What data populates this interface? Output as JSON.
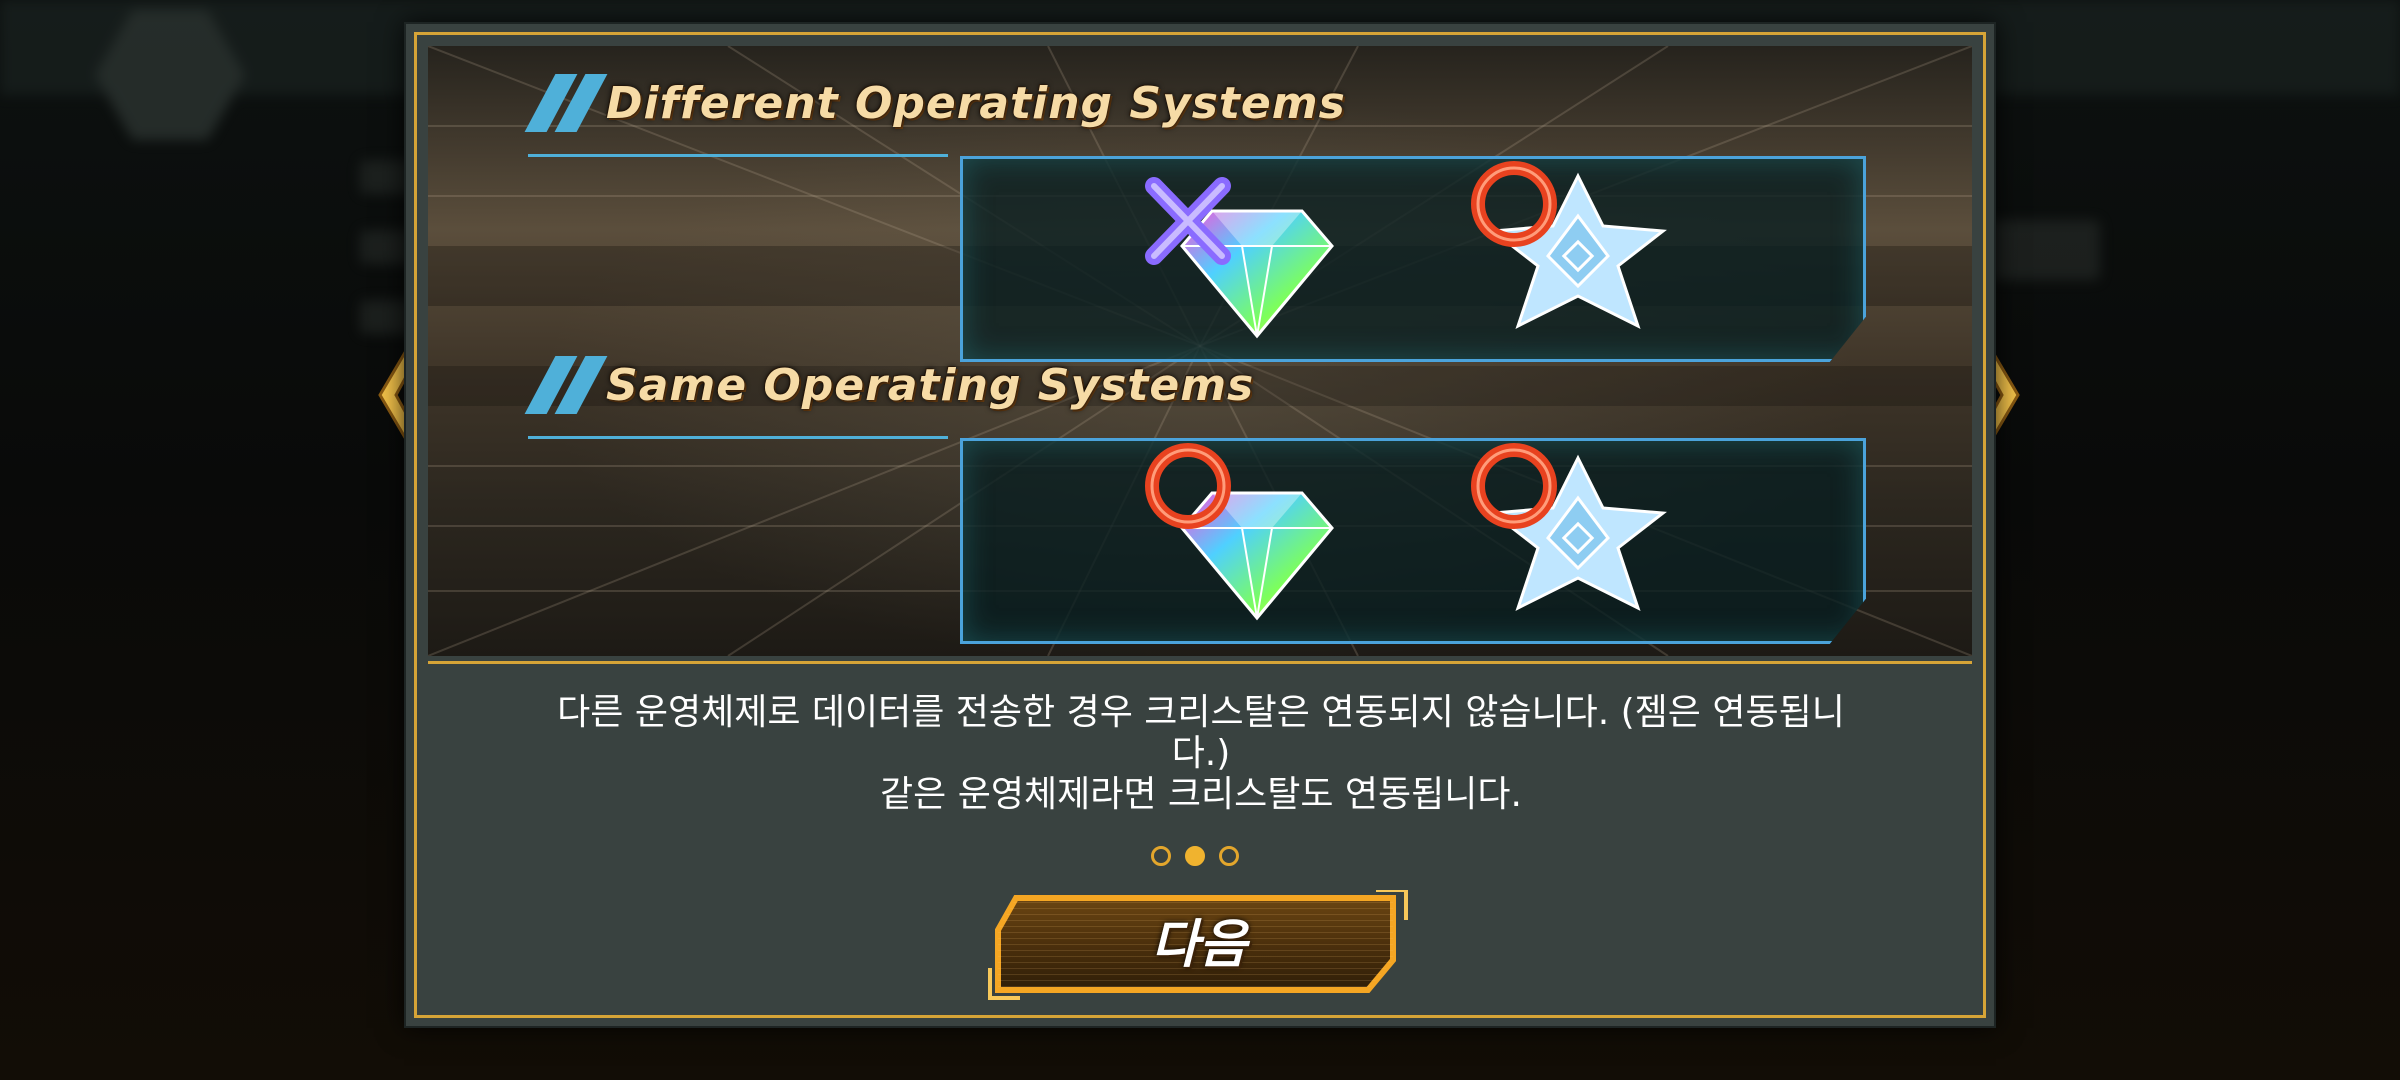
{
  "background": {
    "dimmed": true
  },
  "dialog": {
    "sections": [
      {
        "title": "Different Operating Systems",
        "items": [
          {
            "icon": "gem-icon",
            "status": "not-linked",
            "status_icon": "x-mark-icon"
          },
          {
            "icon": "crystal-icon",
            "status": "linked",
            "status_icon": "circle-mark-icon"
          }
        ]
      },
      {
        "title": "Same Operating Systems",
        "items": [
          {
            "icon": "gem-icon",
            "status": "linked",
            "status_icon": "circle-mark-icon"
          },
          {
            "icon": "crystal-icon",
            "status": "linked",
            "status_icon": "circle-mark-icon"
          }
        ]
      }
    ],
    "message_lines": [
      "다른 운영체제로 데이터를 전송한 경우 크리스탈은 연동되지 않습니다. (젬은 연동됩니",
      "다.)",
      "같은 운영체제라면 크리스탈도 연동됩니다."
    ],
    "pagination": {
      "total": 3,
      "current": 2
    },
    "next_button_label": "다음"
  },
  "colors": {
    "accent_gold": "#d6a437",
    "panel_blue": "#4ba3db",
    "x_purple": "#8a6bff",
    "circle_red": "#e8421f"
  }
}
